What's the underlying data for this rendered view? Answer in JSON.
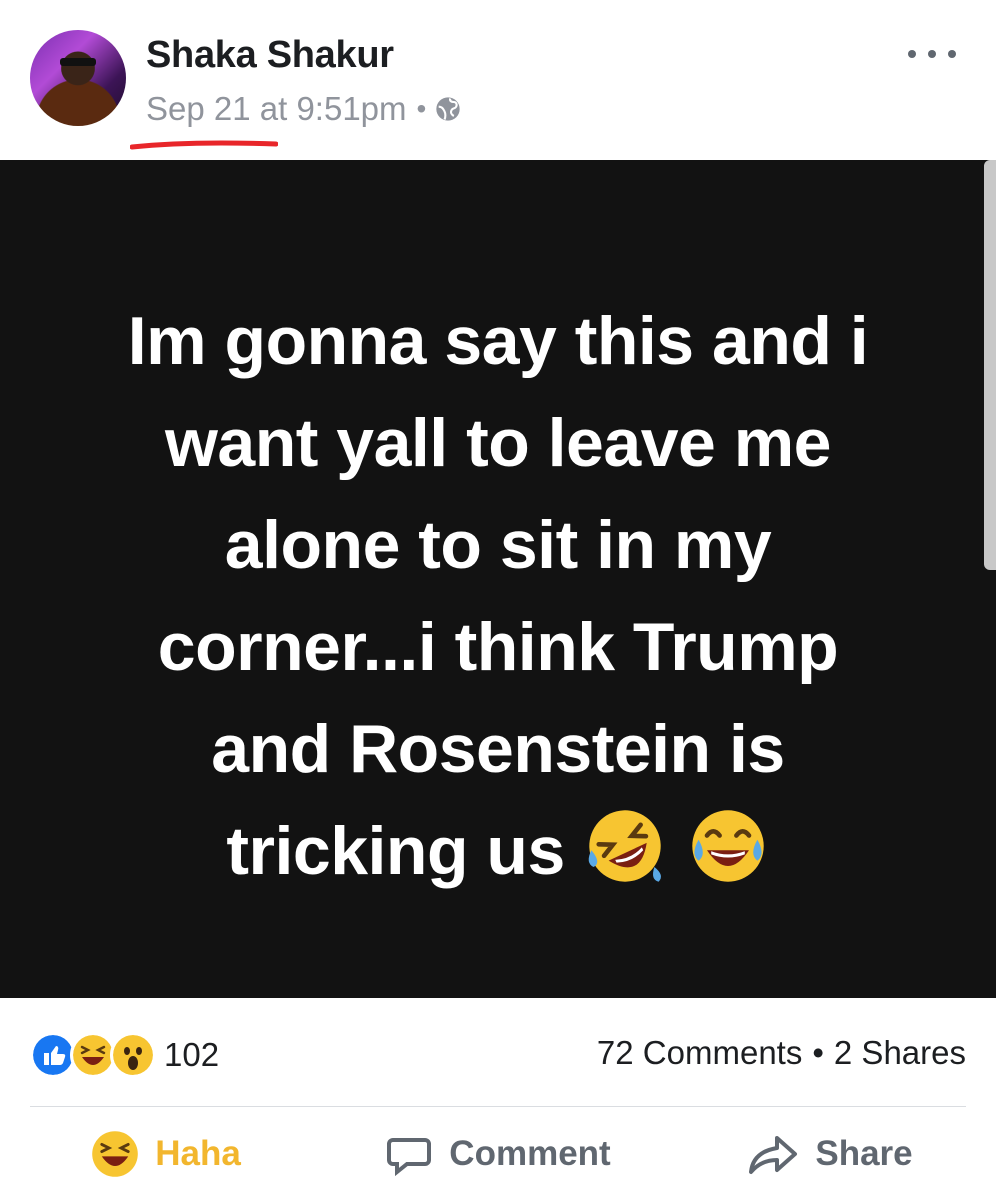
{
  "post": {
    "author": "Shaka Shakur",
    "timestamp": "Sep 21 at 9:51pm",
    "separator": "•",
    "privacy_icon": "globe-icon",
    "more_icon": "more-dots-icon",
    "text_lines": [
      "Im gonna say this and i",
      "want yall to leave me",
      "alone to sit in my",
      "corner...i think Trump",
      "and Rosenstein is",
      "tricking us"
    ],
    "emojis": [
      "rolling-on-floor-laughing-emoji",
      "face-with-tears-of-joy-emoji"
    ]
  },
  "stats": {
    "reaction_icons": [
      "like-icon",
      "haha-icon",
      "wow-icon"
    ],
    "reaction_count": "102",
    "comments": "72 Comments",
    "separator": "•",
    "shares": "2 Shares"
  },
  "actions": {
    "haha_label": "Haha",
    "comment_label": "Comment",
    "share_label": "Share"
  },
  "colors": {
    "image_background": "#121212",
    "haha_active": "#f2b62e",
    "like_blue": "#1877f2",
    "annotation_underline": "#e8262a"
  }
}
